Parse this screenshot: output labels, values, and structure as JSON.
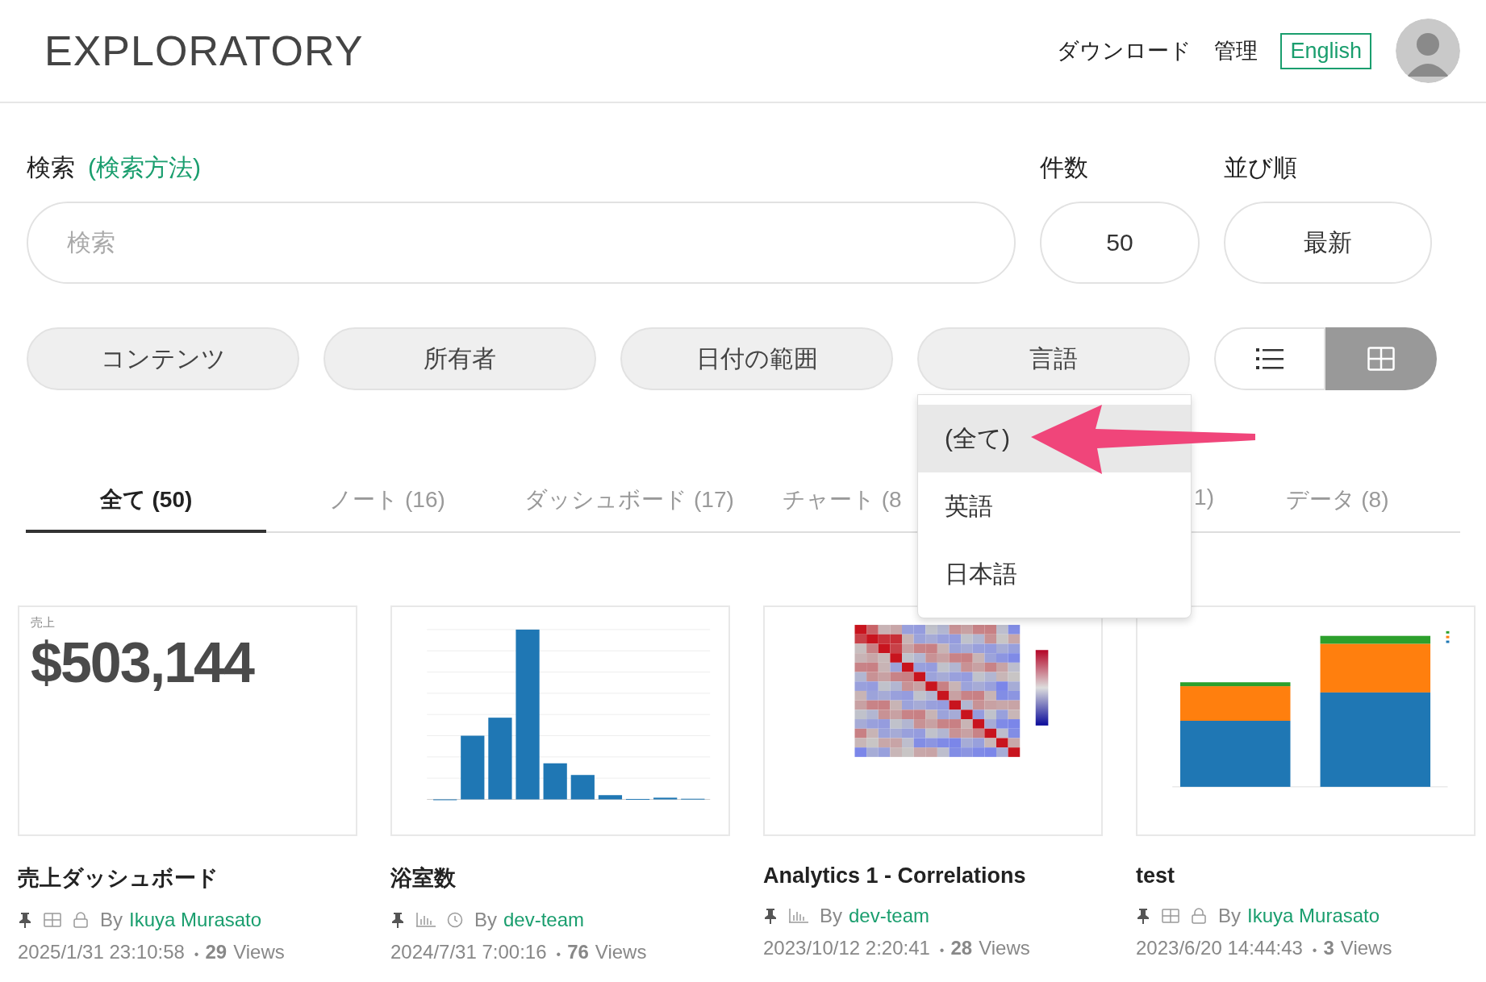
{
  "header": {
    "logo": "EXPLORATORY",
    "nav": [
      {
        "label": "ダウンロード",
        "kind": "link"
      },
      {
        "label": "管理",
        "kind": "link"
      },
      {
        "label": "English",
        "kind": "button"
      }
    ]
  },
  "search": {
    "label": "検索",
    "help_link": "(検索方法)",
    "placeholder": "検索"
  },
  "count": {
    "label": "件数",
    "value": "50"
  },
  "sort": {
    "label": "並び順",
    "value": "最新"
  },
  "filters": [
    "コンテンツ",
    "所有者",
    "日付の範囲",
    "言語"
  ],
  "view_toggle": [
    {
      "kind": "list",
      "selected": false
    },
    {
      "kind": "grid",
      "selected": true
    }
  ],
  "language_menu": [
    {
      "label": "(全て)",
      "selected": true
    },
    {
      "label": "英語",
      "selected": false
    },
    {
      "label": "日本語",
      "selected": false
    }
  ],
  "tabs": [
    {
      "label": "全て (50)",
      "selected": true
    },
    {
      "label": "ノート (16)",
      "selected": false
    },
    {
      "label": "ダッシュボード (17)",
      "selected": false
    },
    {
      "label": "チャート (8",
      "selected": false
    },
    {
      "label": "1)",
      "selected": false
    },
    {
      "label": "データ (8)",
      "selected": false
    }
  ],
  "cards": [
    {
      "thumbnail": {
        "kind": "metric",
        "label": "売上",
        "value": "$503,144"
      },
      "title": "売上ダッシュボード",
      "icons": [
        {
          "kind": "pin"
        },
        {
          "kind": "grid"
        },
        {
          "kind": "lock"
        }
      ],
      "by": "By",
      "owner": "Ikuya Murasato",
      "date": "2025/1/31 23:10:58",
      "separator": "•",
      "views": "29",
      "views_label": "Views"
    },
    {
      "thumbnail": {
        "kind": "bar"
      },
      "title": "浴室数",
      "icons": [
        {
          "kind": "pin"
        },
        {
          "kind": "chart"
        },
        {
          "kind": "clock"
        }
      ],
      "by": "By",
      "owner": "dev-team",
      "date": "2024/7/31 7:00:16",
      "separator": "•",
      "views": "76",
      "views_label": "Views"
    },
    {
      "thumbnail": {
        "kind": "heatmap"
      },
      "title": "Analytics 1 - Correlations",
      "icons": [
        {
          "kind": "pin"
        },
        {
          "kind": "chart"
        }
      ],
      "by": "By",
      "owner": "dev-team",
      "date": "2023/10/12 2:20:41",
      "separator": "•",
      "views": "28",
      "views_label": "Views"
    },
    {
      "thumbnail": {
        "kind": "stacked_bar"
      },
      "title": "test",
      "icons": [
        {
          "kind": "pin"
        },
        {
          "kind": "grid"
        },
        {
          "kind": "lock"
        }
      ],
      "by": "By",
      "owner": "Ikuya Murasato",
      "date": "2023/6/20 14:44:43",
      "separator": "•",
      "views": "3",
      "views_label": "Views"
    }
  ]
}
